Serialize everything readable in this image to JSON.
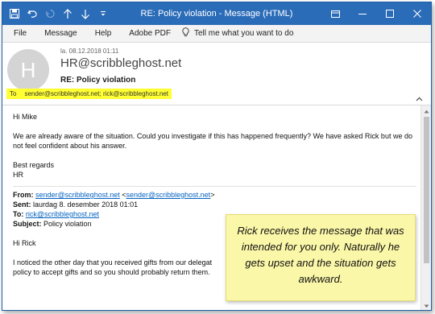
{
  "window": {
    "title": "RE: Policy violation  -  Message (HTML)"
  },
  "menu": {
    "items": [
      "File",
      "Message",
      "Help",
      "Adobe PDF"
    ],
    "tell_me": "Tell me what you want to do"
  },
  "header": {
    "avatar_initial": "H",
    "date": "la. 08.12.2018 01:11",
    "sender": "HR@scribbleghost.net",
    "subject": "RE: Policy violation",
    "to_label": "To",
    "to_value": "sender@scribbleghost.net; rick@scribbleghost.net"
  },
  "message": {
    "greeting": "Hi Mike",
    "paragraph": "We are already aware of the situation. Could you investigate if this has happened frequently? We have asked Rick but we do not feel confident about his answer.",
    "closing": "Best regards",
    "signature": "HR",
    "quoted": {
      "from_label": "From:",
      "from_link": "sender@scribbleghost.net",
      "from_angle": "sender@scribbleghost.net",
      "sent_label": "Sent:",
      "sent_value": "laurdag 8. desember 2018 01:01",
      "to_label": "To:",
      "to_link": "rick@scribbleghost.net",
      "subject_label": "Subject:",
      "subject_value": "Policy violation",
      "greeting": "Hi Rick",
      "body_line1": "I noticed the other day that you received gifts from our delegat",
      "body_line2": "policy to accept gifts and so you should probably return them."
    }
  },
  "note": {
    "text": "Rick receives the message that was intended for you only. Naturally he gets upset and the situation gets awkward."
  },
  "colors": {
    "titlebar": "#2b6cb8",
    "highlight": "#ffff33",
    "note_bg": "#fbf7a8",
    "link": "#0563c1"
  }
}
